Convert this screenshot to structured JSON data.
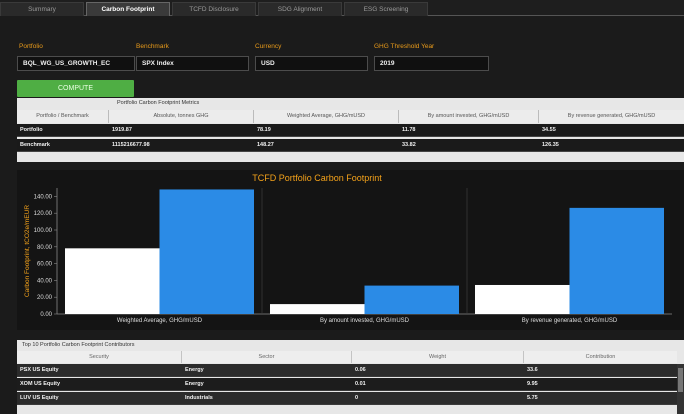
{
  "tabs": [
    {
      "label": "Summary",
      "active": false
    },
    {
      "label": "Carbon Footprint",
      "active": true
    },
    {
      "label": "TCFD Disclosure",
      "active": false
    },
    {
      "label": "SDG Alignment",
      "active": false
    },
    {
      "label": "ESG Screening",
      "active": false
    }
  ],
  "form": {
    "portfolio_label": "Portfolio",
    "portfolio_value": "BQL_WG_US_GROWTH_EC",
    "benchmark_label": "Benchmark",
    "benchmark_value": "SPX Index",
    "currency_label": "Currency",
    "currency_value": "USD",
    "threshold_label": "GHG Threshold Year",
    "threshold_value": "2019"
  },
  "compute_label": "COMPUTE",
  "metrics": {
    "title": "Portfolio Carbon Footprint Metrics",
    "headers": [
      "Portfolio / Benchmark",
      "Absolute, tonnes GHG",
      "Weighted Average, GHG/mUSD",
      "By amount invested, GHG/mUSD",
      "By revenue generated, GHG/mUSD"
    ],
    "rows": [
      [
        "Portfolio",
        "1919.87",
        "78.19",
        "11.78",
        "34.55"
      ],
      [
        "Benchmark",
        "1115216677.98",
        "148.27",
        "33.82",
        "126.35"
      ]
    ]
  },
  "chart_data": {
    "type": "bar",
    "title": "TCFD Portfolio Carbon Footprint",
    "ylabel": "Carbon Footprint, tCO2e/mEUR",
    "ylim": [
      0,
      150
    ],
    "yticks": [
      "0.00",
      "20.00",
      "40.00",
      "60.00",
      "80.00",
      "100.00",
      "120.00",
      "140.00"
    ],
    "categories": [
      "Weighted Average, GHG/mUSD",
      "By amount invested, GHG/mUSD",
      "By revenue generated, GHG/mUSD"
    ],
    "series": [
      {
        "values": [
          78.19,
          11.78,
          34.55
        ],
        "color": "#ffffff"
      },
      {
        "values": [
          148.27,
          33.82,
          126.35
        ],
        "color": "#2b8be6"
      }
    ],
    "title_color": "#f4a21a"
  },
  "contributors": {
    "title": "Top 10 Portfolio Carbon Footprint Contributors",
    "headers": [
      "Security",
      "Sector",
      "Weight",
      "Contribution"
    ],
    "rows": [
      [
        "PSX US Equity",
        "Energy",
        "0.06",
        "33.6"
      ],
      [
        "XOM US Equity",
        "Energy",
        "0.01",
        "9.95"
      ],
      [
        "LUV US Equity",
        "Industrials",
        "0",
        "5.75"
      ]
    ]
  }
}
